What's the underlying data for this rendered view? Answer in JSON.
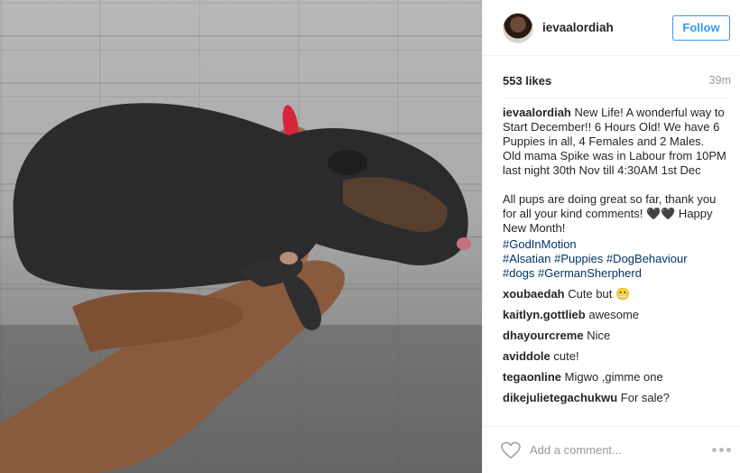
{
  "post": {
    "username": "ievaalordiah",
    "follow_label": "Follow",
    "likes": "553 likes",
    "time": "39m",
    "caption_user": "ievaalordiah",
    "caption_text": "New Life! A wonderful way to Start December!! 6 Hours Old! We have 6 Puppies in all, 4 Females and 2 Males.\nOld mama Spike was in Labour from 10PM last night 30th Nov till 4:30AM 1st Dec\n\nAll pups are doing great so far, thank you for all your kind comments! 🖤🖤 Happy New Month!",
    "hashtags": [
      "#GodInMotion",
      "#Alsatian",
      "#Puppies",
      "#DogBehaviour",
      "#dogs",
      "#GermanSherpherd"
    ]
  },
  "comments": [
    {
      "user": "xoubaedah",
      "text": "Cute but 😬"
    },
    {
      "user": "kaitlyn.gottlieb",
      "text": "awesome"
    },
    {
      "user": "dhayourcreme",
      "text": "Nice"
    },
    {
      "user": "aviddole",
      "text": "cute!"
    },
    {
      "user": "tegaonline",
      "text": "Migwo ,gimme one"
    },
    {
      "user": "dikejulietegachukwu",
      "text": "For sale?"
    }
  ],
  "footer": {
    "add_comment_placeholder": "Add a comment...",
    "like_icon": "heart-outline-icon",
    "more_icon": "more-options-icon"
  },
  "colors": {
    "accent": "#3897f0",
    "hashtag": "#003569",
    "muted": "#999999"
  }
}
